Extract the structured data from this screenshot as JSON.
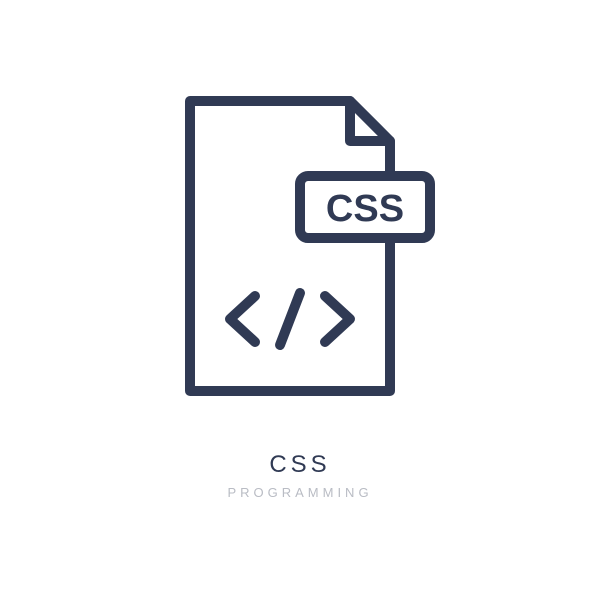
{
  "icon": {
    "badge_text": "CSS",
    "code_symbol": "</>"
  },
  "labels": {
    "title": "CSS",
    "subtitle": "PROGRAMMING"
  },
  "colors": {
    "stroke": "#303a54",
    "muted": "#b9bcc4"
  }
}
